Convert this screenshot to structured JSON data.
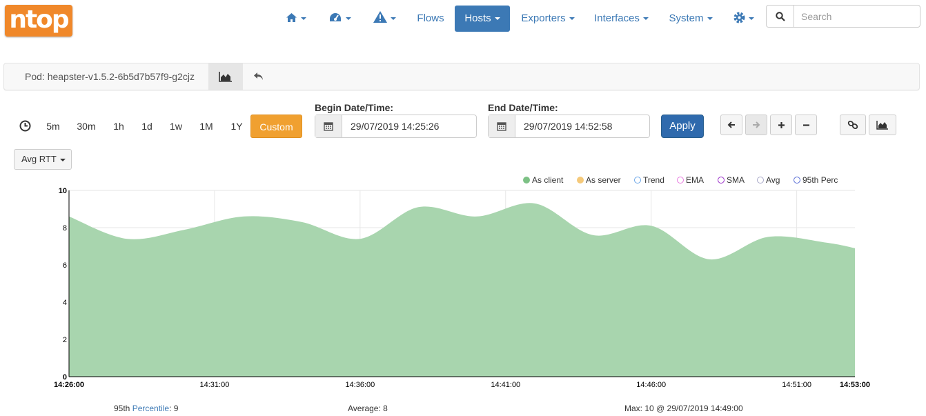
{
  "nav": {
    "logo": "ntop",
    "flows": "Flows",
    "hosts": "Hosts",
    "exporters": "Exporters",
    "interfaces": "Interfaces",
    "system": "System",
    "search_placeholder": "Search"
  },
  "breadcrumb": {
    "pod": "Pod: heapster-v1.5.2-6b5d7b57f9-g2cjz"
  },
  "time_controls": {
    "ranges": [
      "5m",
      "30m",
      "1h",
      "1d",
      "1w",
      "1M",
      "1Y"
    ],
    "custom": "Custom",
    "begin_label": "Begin Date/Time:",
    "begin_value": "29/07/2019 14:25:26",
    "end_label": "End Date/Time:",
    "end_value": "29/07/2019 14:52:58",
    "apply": "Apply"
  },
  "metric_selector": "Avg RTT",
  "legend": [
    {
      "label": "As client",
      "color": "#7dc185",
      "filled": true
    },
    {
      "label": "As server",
      "color": "#f5c97a",
      "filled": true
    },
    {
      "label": "Trend",
      "color": "#6aa6e8",
      "filled": false
    },
    {
      "label": "EMA",
      "color": "#e87ae0",
      "filled": false
    },
    {
      "label": "SMA",
      "color": "#9b2fc9",
      "filled": false
    },
    {
      "label": "Avg",
      "color": "#a8a8c8",
      "filled": false
    },
    {
      "label": "95th Perc",
      "color": "#5a6fd6",
      "filled": false
    }
  ],
  "chart_data": {
    "type": "area",
    "series": [
      {
        "name": "As client",
        "color": "#a8d5ae",
        "x": [
          0,
          2,
          4,
          6,
          8,
          10,
          12,
          14,
          16,
          18,
          20,
          22,
          24,
          26,
          27
        ],
        "values": [
          8.6,
          7.4,
          7.9,
          8.6,
          8.3,
          7.4,
          9.1,
          8.6,
          9.3,
          7.6,
          8.1,
          6.3,
          7.5,
          7.2,
          6.9
        ]
      }
    ],
    "x_ticks": [
      "14:26:00",
      "14:31:00",
      "14:36:00",
      "14:41:00",
      "14:46:00",
      "14:51:00",
      "14:53:00"
    ],
    "y_ticks": [
      "0",
      "2",
      "4",
      "6",
      "8",
      "10"
    ],
    "ylim": [
      0,
      10
    ],
    "grid": true
  },
  "footer": {
    "perc_prefix": "95th",
    "perc_link": "Percentile",
    "perc_value": ": 9",
    "average": "Average: 8",
    "max": "Max: 10 @ 29/07/2019 14:49:00"
  }
}
